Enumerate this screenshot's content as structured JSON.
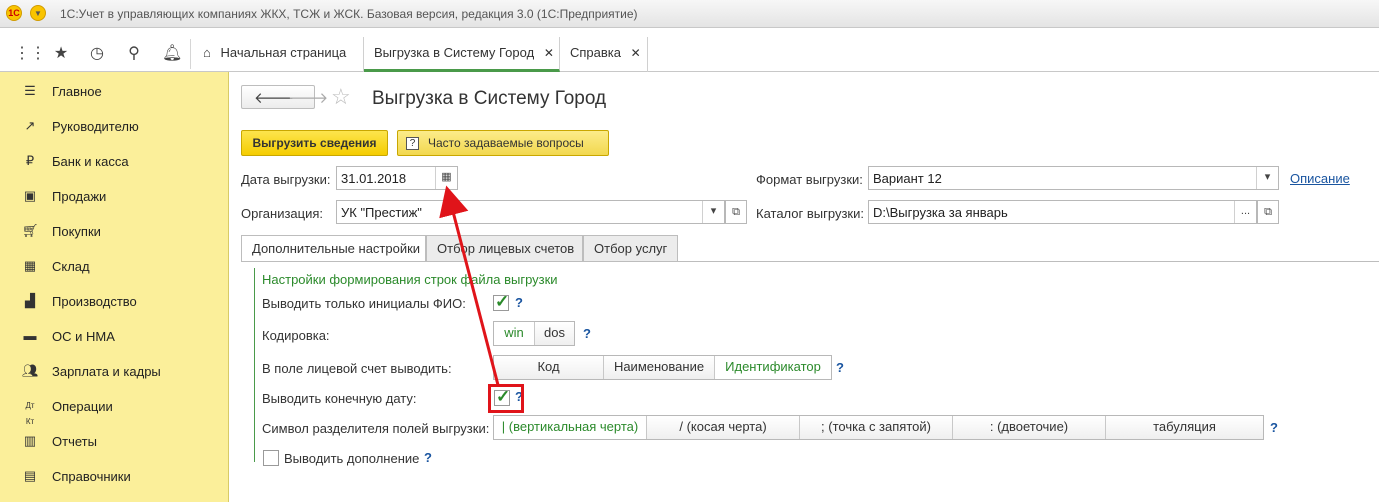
{
  "window": {
    "title": "1С:Учет в управляющих компаниях ЖКХ, ТСЖ и ЖСК. Базовая версия, редакция 3.0  (1С:Предприятие)",
    "logo": "1С"
  },
  "tabs": [
    {
      "label": "Начальная страница",
      "icon": "home-icon"
    },
    {
      "label": "Выгрузка в Систему Город",
      "close": "✕"
    },
    {
      "label": "Справка",
      "close": "✕"
    }
  ],
  "sidebar": {
    "items": [
      {
        "label": "Главное",
        "icon": "menu-lines-icon"
      },
      {
        "label": "Руководителю",
        "icon": "chart-trend-icon"
      },
      {
        "label": "Банк и касса",
        "icon": "ruble-coin-icon"
      },
      {
        "label": "Продажи",
        "icon": "shopping-bag-icon"
      },
      {
        "label": "Покупки",
        "icon": "cart-icon"
      },
      {
        "label": "Склад",
        "icon": "warehouse-icon"
      },
      {
        "label": "Производство",
        "icon": "factory-icon"
      },
      {
        "label": "ОС и НМА",
        "icon": "assets-icon"
      },
      {
        "label": "Зарплата и кадры",
        "icon": "people-icon"
      },
      {
        "label": "Операции",
        "icon": "dt-kt-icon"
      },
      {
        "label": "Отчеты",
        "icon": "report-icon"
      },
      {
        "label": "Справочники",
        "icon": "reference-books-icon"
      }
    ]
  },
  "page": {
    "title": "Выгрузка в Систему Город",
    "export_button": "Выгрузить сведения",
    "faq_button": "Часто задаваемые вопросы",
    "faq_icon_glyph": "?"
  },
  "form": {
    "date_label": "Дата выгрузки:",
    "date_value": "31.01.2018",
    "format_label": "Формат выгрузки:",
    "format_value": "Вариант 12",
    "description_link": "Описание",
    "org_label": "Организация:",
    "org_value": "УК \"Престиж\"",
    "catalog_label": "Каталог выгрузки:",
    "catalog_value": "D:\\Выгрузка за январь",
    "catalog_browse": "..."
  },
  "form_tabs": [
    "Дополнительные настройки",
    "Отбор лицевых счетов",
    "Отбор услуг"
  ],
  "settings": {
    "section_title": "Настройки формирования строк файла выгрузки",
    "help": "?",
    "initials_label": "Выводить только инициалы ФИО:",
    "initials_checked": true,
    "encoding_label": "Кодировка:",
    "encoding_options": [
      "win",
      "dos"
    ],
    "encoding_selected": "win",
    "account_label": "В поле лицевой счет выводить:",
    "account_options": [
      "Код",
      "Наименование",
      "Идентификатор"
    ],
    "account_selected": "Идентификатор",
    "enddate_label": "Выводить конечную дату:",
    "enddate_checked": true,
    "separator_label": "Символ разделителя полей выгрузки:",
    "separator_options": [
      "| (вертикальная черта)",
      "/ (косая черта)",
      "; (точка с запятой)",
      ": (двоеточие)",
      "табуляция"
    ],
    "separator_selected": "| (вертикальная черта)",
    "addition_label": "Выводить дополнение",
    "addition_checked": false
  },
  "colors": {
    "sidebar_bg": "#fbef9a",
    "accent_green": "#2b8a2b",
    "annotation_red": "#e0141a",
    "link_blue": "#1a55a0"
  }
}
